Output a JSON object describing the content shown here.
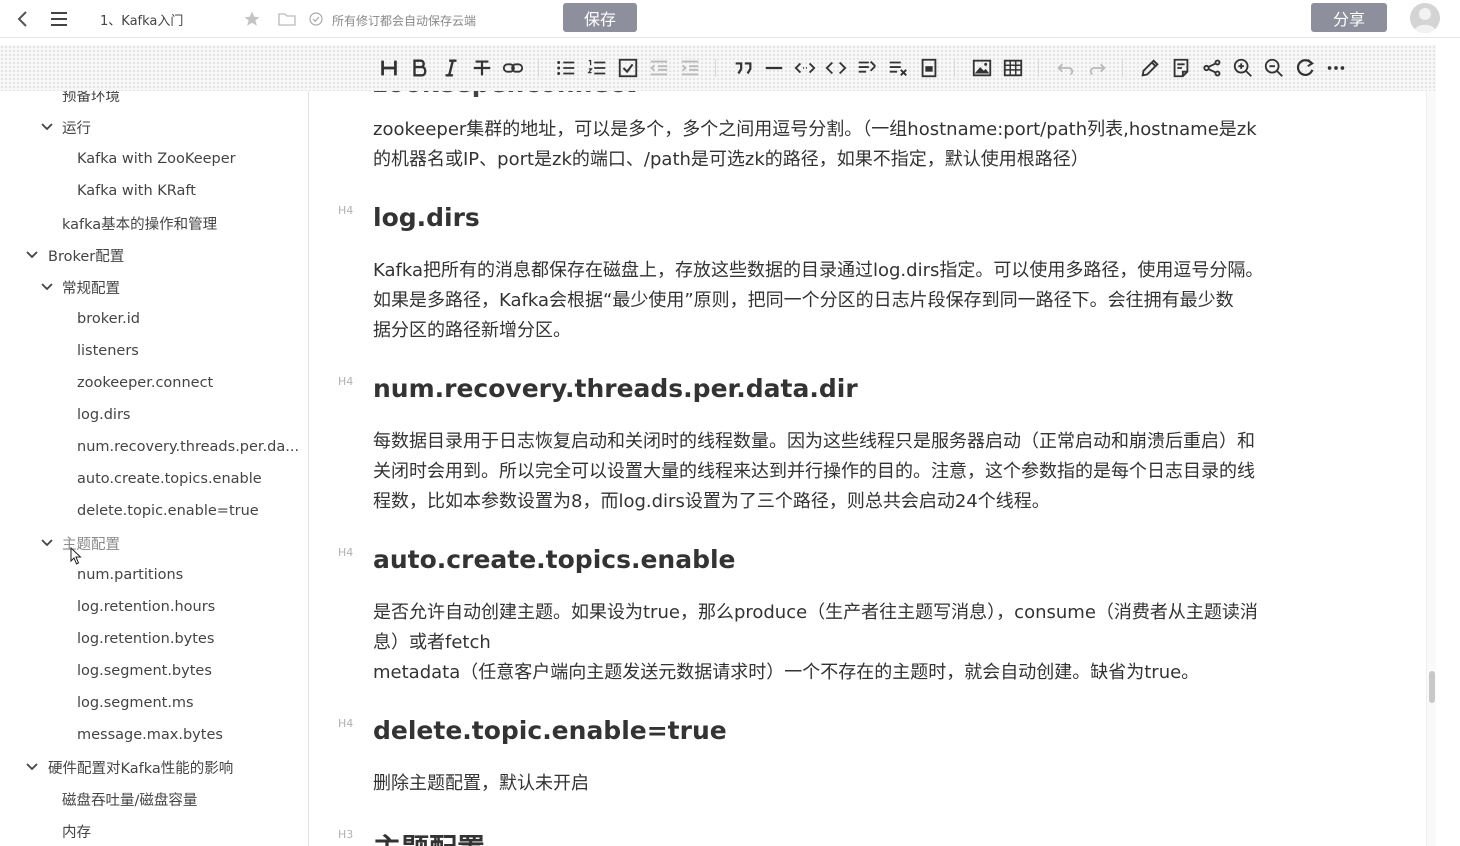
{
  "topbar": {
    "doc_title": "1、Kafka入门",
    "autosave_text": "所有修订都会自动保存云端",
    "save_label": "保存",
    "share_label": "分享"
  },
  "sidebar": {
    "items": [
      {
        "label": "预备环境"
      },
      {
        "label": "运行"
      },
      {
        "label": "Kafka with ZooKeeper"
      },
      {
        "label": "Kafka with KRaft"
      },
      {
        "label": "kafka基本的操作和管理"
      },
      {
        "label": "Broker配置"
      },
      {
        "label": "常规配置"
      },
      {
        "label": "broker.id"
      },
      {
        "label": "listeners"
      },
      {
        "label": "zookeeper.connect"
      },
      {
        "label": "log.dirs"
      },
      {
        "label": "num.recovery.threads.per.da..."
      },
      {
        "label": "auto.create.topics.enable"
      },
      {
        "label": "delete.topic.enable=true"
      },
      {
        "label": "主题配置"
      },
      {
        "label": "num.partitions"
      },
      {
        "label": "log.retention.hours"
      },
      {
        "label": "log.retention.bytes"
      },
      {
        "label": "log.segment.bytes"
      },
      {
        "label": "log.segment.ms"
      },
      {
        "label": "message.max.bytes"
      },
      {
        "label": "硬件配置对Kafka性能的影响"
      },
      {
        "label": "磁盘吞吐量/磁盘容量"
      },
      {
        "label": "内存"
      }
    ]
  },
  "content": {
    "intro": {
      "lines": [
        "zookeeper集群的地址，可以是多个，多个之间用逗号分割。（一组hostname:port/path列表,hostname是zk",
        "的机器名或IP、port是zk的端口、/path是可选zk的路径，如果不指定，默认使用根路径）"
      ]
    },
    "sections": [
      {
        "level": "H4",
        "heading": "log.dirs",
        "lines": [
          "Kafka把所有的消息都保存在磁盘上，存放这些数据的目录通过log.dirs指定。可以使用多路径，使用逗号分隔。",
          "如果是多路径，Kafka会根据“最少使用”原则，把同一个分区的日志片段保存到同一路径下。会往拥有最少数",
          "据分区的路径新增分区。"
        ]
      },
      {
        "level": "H4",
        "heading": "num.recovery.threads.per.data.dir",
        "lines": [
          "每数据目录用于日志恢复启动和关闭时的线程数量。因为这些线程只是服务器启动（正常启动和崩溃后重启）和",
          "关闭时会用到。所以完全可以设置大量的线程来达到并行操作的目的。注意，这个参数指的是每个日志目录的线",
          "程数，比如本参数设置为8，而log.dirs设置为了三个路径，则总共会启动24个线程。"
        ]
      },
      {
        "level": "H4",
        "heading": "auto.create.topics.enable",
        "lines": [
          "是否允许自动创建主题。如果设为true，那么produce（生产者往主题写消息），consume（消费者从主题读消",
          "息）或者fetch",
          "metadata（任意客户端向主题发送元数据请求时）一个不存在的主题时，就会自动创建。缺省为true。"
        ]
      },
      {
        "level": "H4",
        "heading": "delete.topic.enable=true",
        "lines": [
          "删除主题配置，默认未开启"
        ]
      },
      {
        "level": "H3",
        "heading": "主题配置",
        "lines": []
      }
    ]
  }
}
